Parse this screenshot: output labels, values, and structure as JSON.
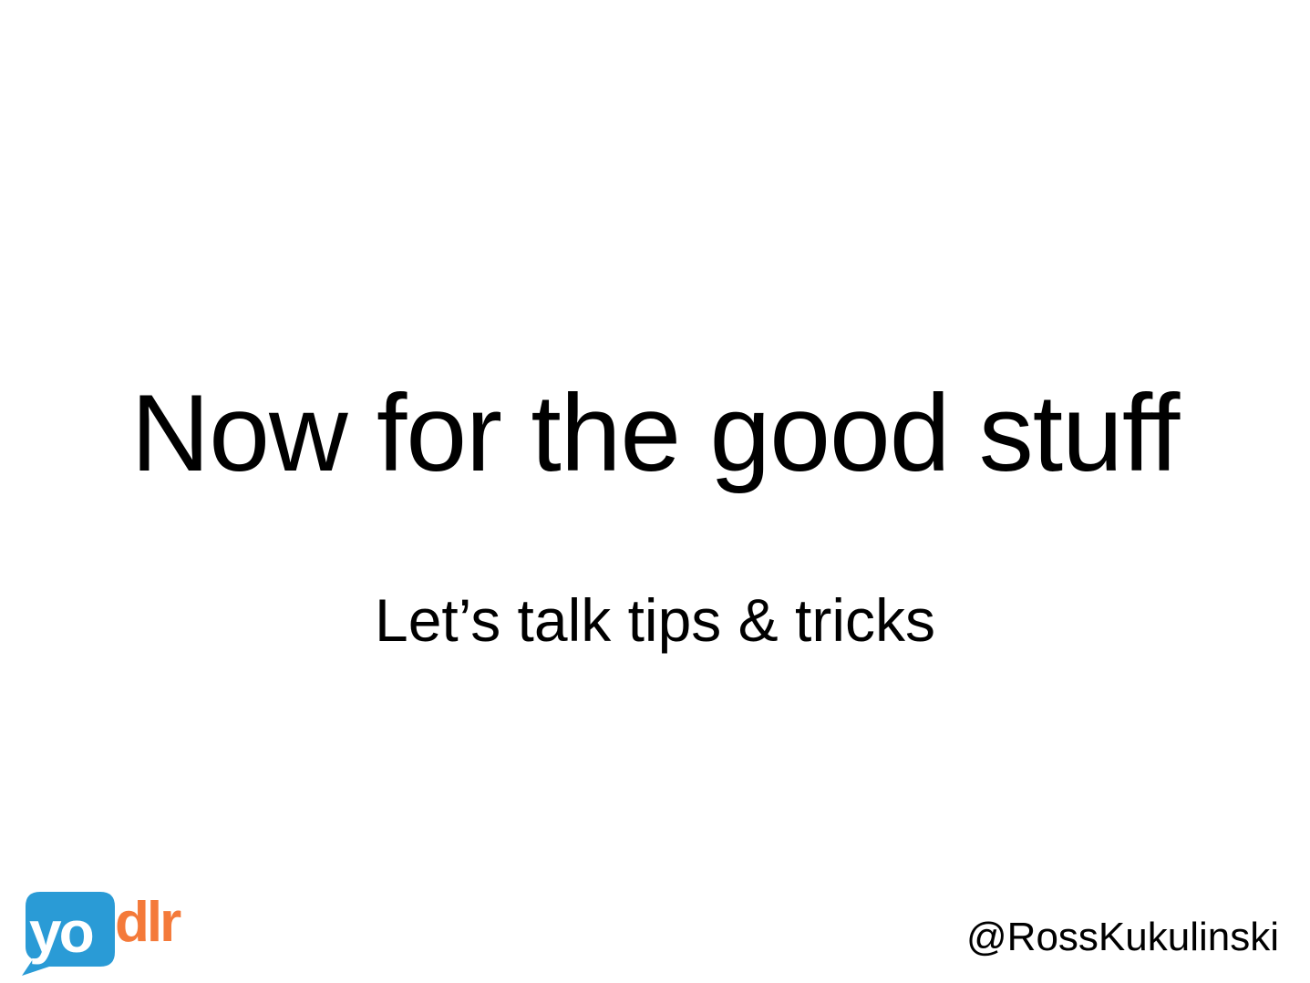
{
  "slide": {
    "title": "Now for the good stuff",
    "subtitle": "Let’s talk tips & tricks",
    "handle": "@RossKukulinski"
  },
  "logo": {
    "text_part1": "yo",
    "text_part2": "dlr",
    "colors": {
      "bubble": "#2a9bd6",
      "text_on_bubble": "#ffffff",
      "accent": "#f47a3a"
    }
  }
}
